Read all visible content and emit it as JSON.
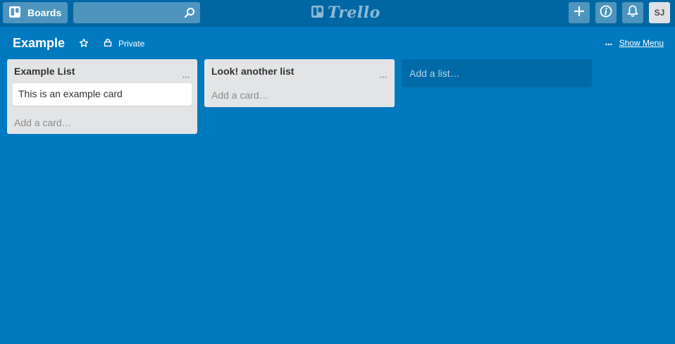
{
  "header": {
    "boards_label": "Boards",
    "search_placeholder": "",
    "logo_text": "Trello",
    "avatar_initials": "SJ"
  },
  "board": {
    "title": "Example",
    "privacy_label": "Private",
    "show_menu_label": "Show Menu"
  },
  "lists": [
    {
      "title": "Example List",
      "cards": [
        "This is an example card"
      ],
      "add_card_label": "Add a card…"
    },
    {
      "title": "Look! another list",
      "cards": [],
      "add_card_label": "Add a card…"
    }
  ],
  "add_list_label": "Add a list…",
  "icons": {
    "boards": "boards-icon",
    "search": "search-icon",
    "logo": "trello-logo-icon",
    "add": "plus-icon",
    "info": "info-icon",
    "notifications": "bell-icon",
    "star": "star-icon",
    "privacy": "lock-icon",
    "menu": "ellipsis-icon"
  },
  "colors": {
    "board_background": "#0079bf",
    "header_background": "#0067a3",
    "list_background": "#e2e4e6"
  }
}
